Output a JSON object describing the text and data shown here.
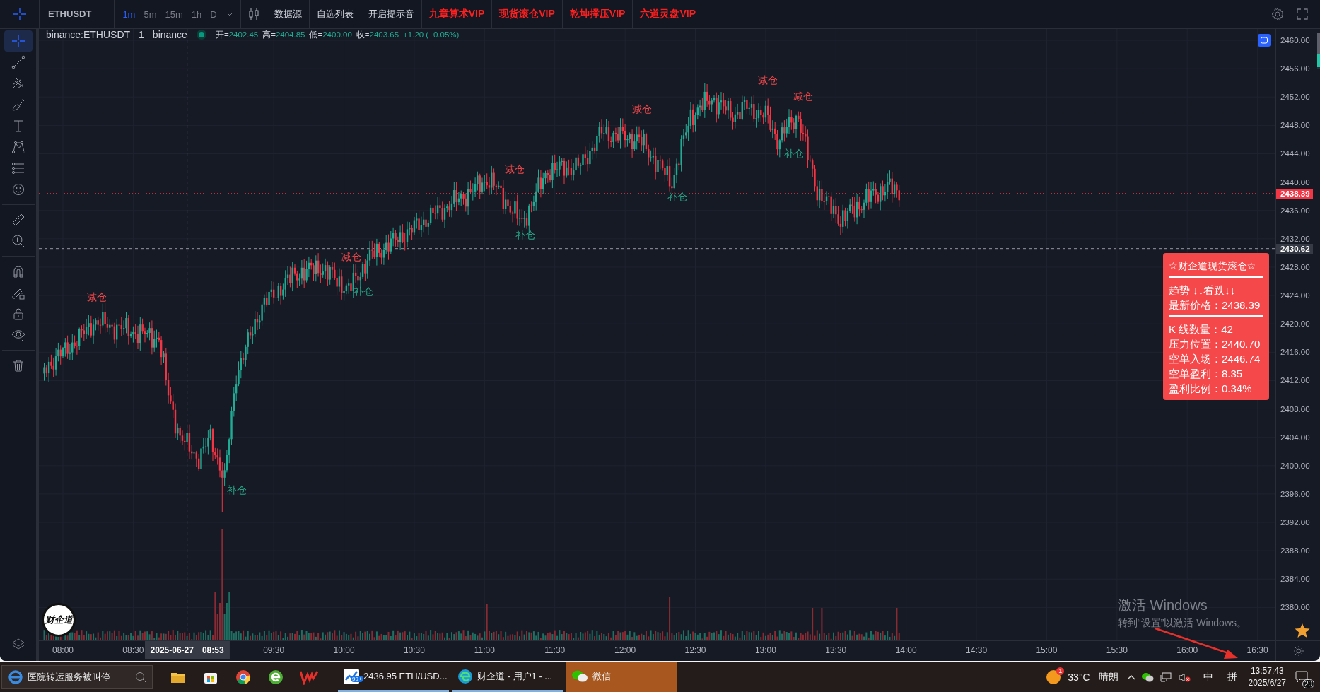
{
  "toolbar": {
    "symbol": "ETHUSDT",
    "intervals": [
      {
        "label": "1m",
        "selected": true
      },
      {
        "label": "5m",
        "selected": false
      },
      {
        "label": "15m",
        "selected": false
      },
      {
        "label": "1h",
        "selected": false
      },
      {
        "label": "D",
        "selected": false
      }
    ],
    "buttons": [
      {
        "label": "数据源",
        "kind": "plain"
      },
      {
        "label": "自选列表",
        "kind": "plain"
      },
      {
        "label": "开启提示音",
        "kind": "plain"
      },
      {
        "label": "九章算术VIP",
        "kind": "vip"
      },
      {
        "label": "现货滚仓VIP",
        "kind": "vip"
      },
      {
        "label": "乾坤撑压VIP",
        "kind": "vip"
      },
      {
        "label": "六道灵盘VIP",
        "kind": "vip"
      }
    ]
  },
  "drawing_tools": [
    {
      "kind": "crosshair",
      "selected": true
    },
    {
      "kind": "line",
      "selected": false
    },
    {
      "kind": "pitchfork",
      "selected": false
    },
    {
      "kind": "brush",
      "selected": false
    },
    {
      "kind": "text",
      "selected": false
    },
    {
      "kind": "pattern",
      "selected": false
    },
    {
      "kind": "fib",
      "selected": false
    },
    {
      "kind": "emoji",
      "selected": false
    },
    {
      "kind": "ruler",
      "selected": false
    },
    {
      "kind": "zoom",
      "selected": false
    },
    {
      "kind": "magnet",
      "selected": false
    },
    {
      "kind": "pencil-lock",
      "selected": false
    },
    {
      "kind": "lock",
      "selected": false
    },
    {
      "kind": "eye",
      "selected": false
    },
    {
      "kind": "trash",
      "selected": false
    }
  ],
  "legend": {
    "symbol": "binance:ETHUSDT",
    "interval": "1",
    "exchange": "binance",
    "ohlc": [
      {
        "label": "开=",
        "value": "2402.45"
      },
      {
        "label": "高=",
        "value": "2404.85"
      },
      {
        "label": "低=",
        "value": "2400.00"
      },
      {
        "label": "收=",
        "value": "2403.65"
      }
    ],
    "change": "+1.20 (+0.05%)"
  },
  "chart": {
    "markers": [
      {
        "kind": "reduce",
        "label": "减仓"
      },
      {
        "kind": "add",
        "label": "补仓"
      },
      {
        "kind": "reduce",
        "label": "减仓"
      },
      {
        "kind": "add",
        "label": "补仓"
      },
      {
        "kind": "reduce",
        "label": "减仓"
      },
      {
        "kind": "add",
        "label": "补仓"
      },
      {
        "kind": "reduce",
        "label": "减仓"
      },
      {
        "kind": "add",
        "label": "补仓"
      },
      {
        "kind": "reduce",
        "label": "减仓"
      },
      {
        "kind": "reduce",
        "label": "减仓"
      },
      {
        "kind": "add",
        "label": "补仓"
      }
    ],
    "logo": "财企道",
    "price_labels": [
      "2460.00",
      "2456.00",
      "2452.00",
      "2448.00",
      "2444.00",
      "2440.00",
      "2436.00",
      "2432.00",
      "2428.00",
      "2424.00",
      "2420.00",
      "2416.00",
      "2412.00",
      "2408.00",
      "2404.00",
      "2400.00",
      "2396.00",
      "2392.00",
      "2388.00",
      "2384.00",
      "2380.00"
    ],
    "last_price": "2438.39",
    "crosshair_price": "2430.62",
    "time_labels": [
      "08:00",
      "08:30",
      "09:30",
      "10:00",
      "10:30",
      "11:00",
      "11:30",
      "12:00",
      "12:30",
      "13:00",
      "13:30",
      "14:00",
      "14:30",
      "15:00",
      "15:30",
      "16:00",
      "16:30"
    ],
    "crosshair_date": "2025-06-27",
    "crosshair_time": "08:53"
  },
  "info_panel": {
    "title": "☆财企道现货滚仓☆",
    "sections": [
      [
        "趋势 ↓↓看跌↓↓",
        "最新价格：2438.39"
      ],
      [
        "K 线数量：42",
        "压力位置：2440.70",
        "空单入场：2446.74",
        "空单盈利：8.35",
        "盈利比例：0.34%"
      ]
    ]
  },
  "watermark": {
    "title": "激活 Windows",
    "subtitle": "转到“设置”以激活 Windows。"
  },
  "taskbar": {
    "search": "医院转运服务被叫停",
    "apps": [
      {
        "kind": "stock",
        "label": "2436.95 ETH/USD...",
        "badge": "99+",
        "flashing": false
      },
      {
        "kind": "browser",
        "label": "财企道 - 用户1 - ...",
        "flashing": false
      },
      {
        "kind": "wechat",
        "label": "微信",
        "flashing": true
      }
    ],
    "weather": {
      "badge": "1",
      "temperature": "33°C",
      "condition": "晴朗"
    },
    "ime": "中",
    "ime_mode": "拼",
    "time": "13:57:43",
    "date": "2025/6/27",
    "notifications": "20"
  }
}
